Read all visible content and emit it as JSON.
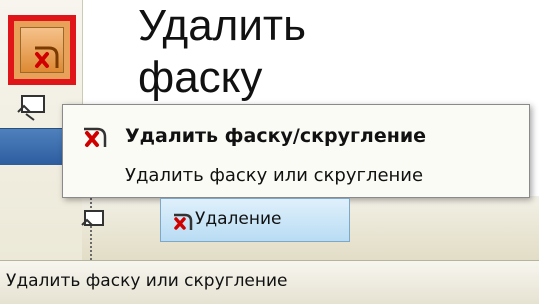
{
  "caption": {
    "line1": "Удалить",
    "line2": "фаску"
  },
  "tooltip": {
    "title": "Удалить фаску/скругление",
    "description": "Удалить фаску или скругление"
  },
  "tabs": [
    {
      "label": "Удаление"
    }
  ],
  "statusbar": {
    "text": "Удалить фаску или скругление"
  },
  "colors": {
    "highlight_border": "#e0151a",
    "tooltip_bg": "#fbfbf6",
    "toolbar_bg": "#ece9d8",
    "tab_bg": "#dff0fb",
    "accent_blue": "#2d5d9f"
  },
  "icons": {
    "delete_fillet": "delete-fillet-icon",
    "tool_small": "toolbar-tool-icon"
  }
}
